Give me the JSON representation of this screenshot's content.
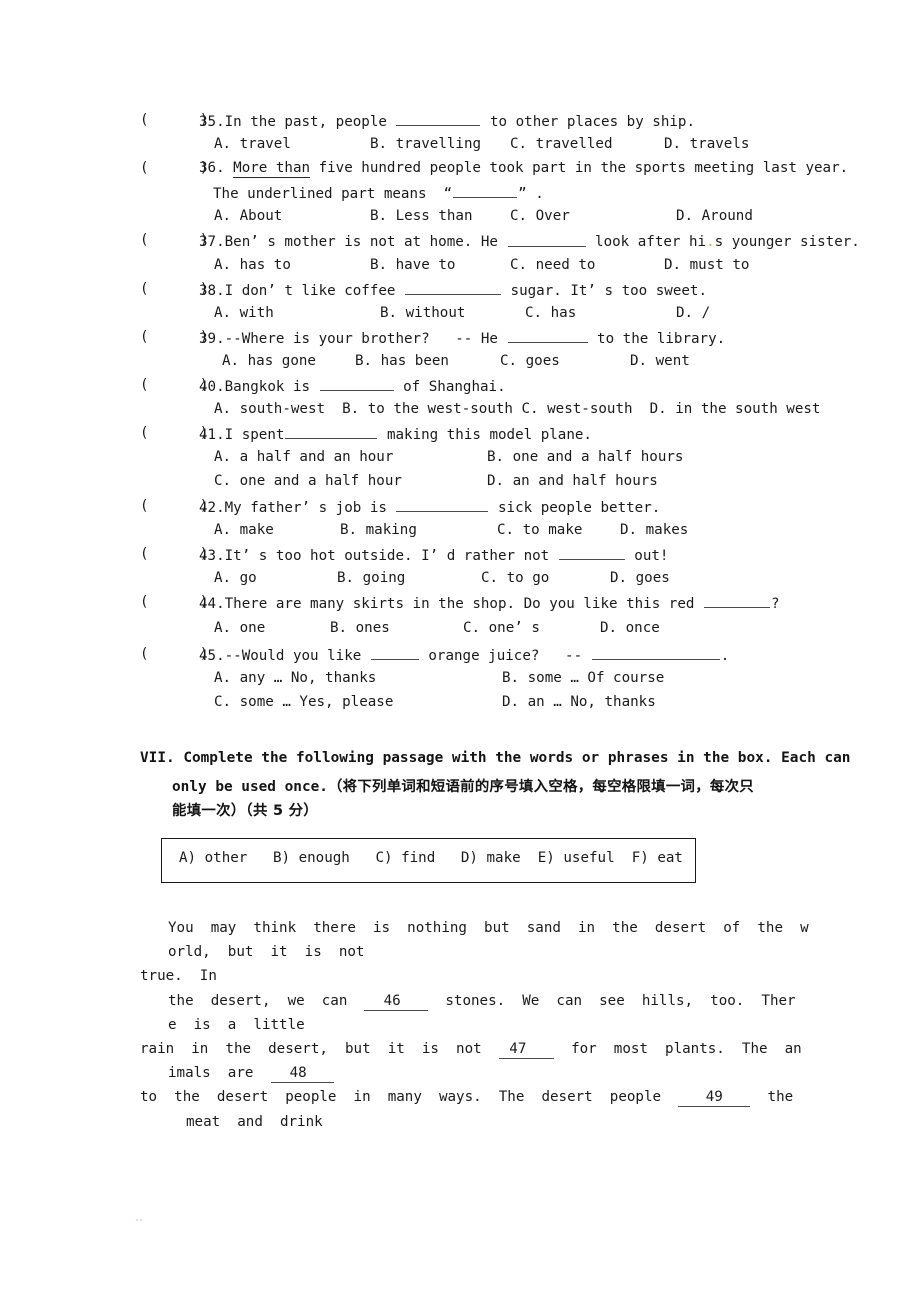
{
  "document": {
    "type": "english-exam-paper",
    "page_background": "#ffffff"
  },
  "multiple_choice": {
    "questions": [
      {
        "marker": "(      )",
        "number": "35.",
        "stem_before": "In the past, people ",
        "stem_after": " to other places by ship.",
        "options": [
          "A. travel",
          "B. travelling",
          "C. travelled",
          "D. travels"
        ]
      },
      {
        "marker": "(      )",
        "number": "36.",
        "stem_underlined": "More than",
        "stem_rest": " five hundred people took part in the sports meeting last year.",
        "stem_line2_before": "The underlined part means  “",
        "stem_line2_after": "” .",
        "options": [
          "A. About",
          "B. Less than",
          "C. Over",
          "D. Around"
        ]
      },
      {
        "marker": "(      )",
        "number": "37.",
        "stem_before": "Ben’ s mother is not at home. He ",
        "stem_after": " look after hi",
        "stem_artifact": ".",
        "stem_after2": "s younger sister.",
        "options": [
          "A. has to",
          "B. have to",
          "C. need to",
          "D. must to"
        ]
      },
      {
        "marker": "(      )",
        "number": "38.",
        "stem_before": "I don’ t like coffee ",
        "stem_after": " sugar. It’ s too sweet.",
        "options": [
          "A. with",
          "B. without",
          "C. has",
          "D. /"
        ]
      },
      {
        "marker": "(      )",
        "number": "39.",
        "stem_before": "--Where is your brother?   -- He ",
        "stem_after": " to the library.",
        "options": [
          "A. has gone",
          "B. has been",
          "C. goes",
          "D. went"
        ]
      },
      {
        "marker": "(      )",
        "number": "40.",
        "stem_before": "Bangkok is ",
        "stem_after": " of Shanghai.",
        "options_flow": "A. south-west  B. to the west-south C. west-south  D. in the south west"
      },
      {
        "marker": "(      )",
        "number": "41.",
        "stem_before": "I spent",
        "stem_after": " making this model plane.",
        "options_grid": [
          [
            "A. a half and an hour",
            "B. one and a half hours"
          ],
          [
            "C. one and a half hour",
            "D. an and half hours"
          ]
        ]
      },
      {
        "marker": "(      )",
        "number": "42.",
        "stem_before": "My father’ s job is ",
        "stem_after": " sick people better.",
        "options": [
          "A. make",
          "B. making",
          "C. to make",
          "D. makes"
        ]
      },
      {
        "marker": "(      )",
        "number": "43.",
        "stem_before": "It’ s too hot outside. I’ d rather not ",
        "stem_after": " out!",
        "options": [
          "A. go",
          "B. going",
          "C. to go",
          "D. goes"
        ]
      },
      {
        "marker": "(      )",
        "number": "44.",
        "stem_before": "There are many skirts in the shop. Do you like this red ",
        "stem_after": "?",
        "options": [
          "A. one",
          "B. ones",
          "C. one’ s",
          "D. once"
        ]
      },
      {
        "marker": "(      )",
        "number": "45.",
        "stem_before": "--Would you like ",
        "stem_mid": " orange juice?   -- ",
        "stem_after": ".",
        "options_grid": [
          [
            "A. any … No, thanks",
            "B. some … Of course"
          ],
          [
            "C. some … Yes, please",
            "D. an … No, thanks"
          ]
        ]
      }
    ]
  },
  "section_seven": {
    "line1": "VII. Complete the following passage with the words or phrases in the box. Each can",
    "line2_en": "only be used once.",
    "line2_cn": "（将下列单词和短语前的序号填入空格，每空格限填一词，每次只",
    "line3_cn": "能填一次）（共 5 分）"
  },
  "word_bank": {
    "content": "A) other   B) enough   C) find   D) make  E) useful  F) eat",
    "items": [
      {
        "letter": "A)",
        "word": "other"
      },
      {
        "letter": "B)",
        "word": "enough"
      },
      {
        "letter": "C)",
        "word": "find"
      },
      {
        "letter": "D)",
        "word": "make"
      },
      {
        "letter": "E)",
        "word": "useful"
      },
      {
        "letter": "F)",
        "word": "eat"
      }
    ]
  },
  "passage": {
    "lines": [
      {
        "indent": "a",
        "text": "You  may  think  there  is  nothing  but  sand  in  the  desert  of  the  w"
      },
      {
        "indent": "a",
        "text": "orld,  but  it  is  not"
      },
      {
        "indent": "b",
        "text": "true.  In"
      },
      {
        "indent": "a",
        "text_before": "the  desert,  we  can  ",
        "blank_no": "46",
        "text_after": "  stones.  We  can  see  hills,  too.  Ther"
      },
      {
        "indent": "a",
        "text": "e  is  a  little"
      },
      {
        "indent": "b",
        "text_before": "rain  in  the  desert,  but  it  is  not  ",
        "blank_no": "47",
        "text_after": "  for  most  plants.  The  an"
      },
      {
        "indent": "a",
        "text_before": "imals  are  ",
        "blank_no": "48",
        "text_after": ""
      },
      {
        "indent": "b",
        "text_before": "to  the  desert  people  in  many  ways.  The  desert  people  ",
        "blank_no": "49",
        "text_after": "  the"
      },
      {
        "indent": "c",
        "text": "meat  and  drink"
      }
    ]
  }
}
